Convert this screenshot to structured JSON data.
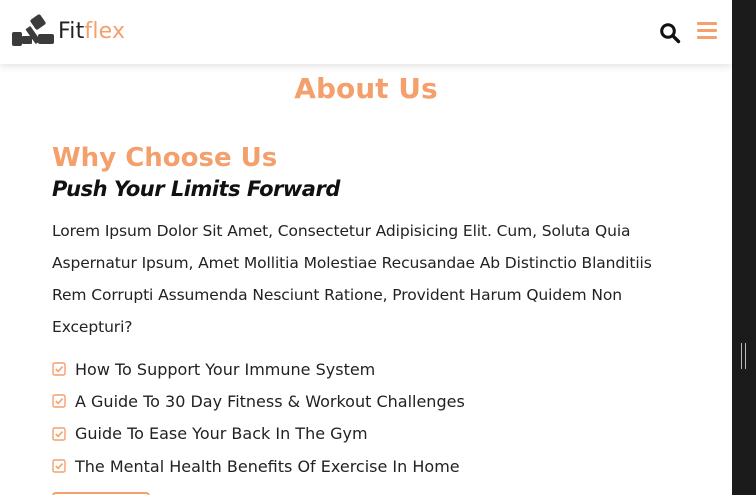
{
  "brand": {
    "name_part1": "Fit",
    "name_part2": "flex"
  },
  "header": {
    "search_icon": "search-icon",
    "menu_icon": "hamburger-menu-icon"
  },
  "page": {
    "title": "About Us"
  },
  "about": {
    "heading": "Why Choose Us",
    "subheading": "Push Your Limits Forward",
    "paragraph": "Lorem Ipsum Dolor Sit Amet, Consectetur Adipisicing Elit. Cum, Soluta Quia Aspernatur Ipsum, Amet Mollitia Molestiae Recusandae Ab Distinctio Blanditiis Rem Corrupti Assumenda Nesciunt Ratione, Provident Harum Quidem Non Excepturi?",
    "list": [
      "How To Support Your Immune System",
      "A Guide To 30 Day Fitness & Workout Challenges",
      "Guide To Ease Your Back In The Gym",
      "The Mental Health Benefits Of Exercise In Home"
    ]
  },
  "colors": {
    "accent": "#f4a06c",
    "text": "#222222",
    "scrollbar": "#1b1b1b"
  }
}
